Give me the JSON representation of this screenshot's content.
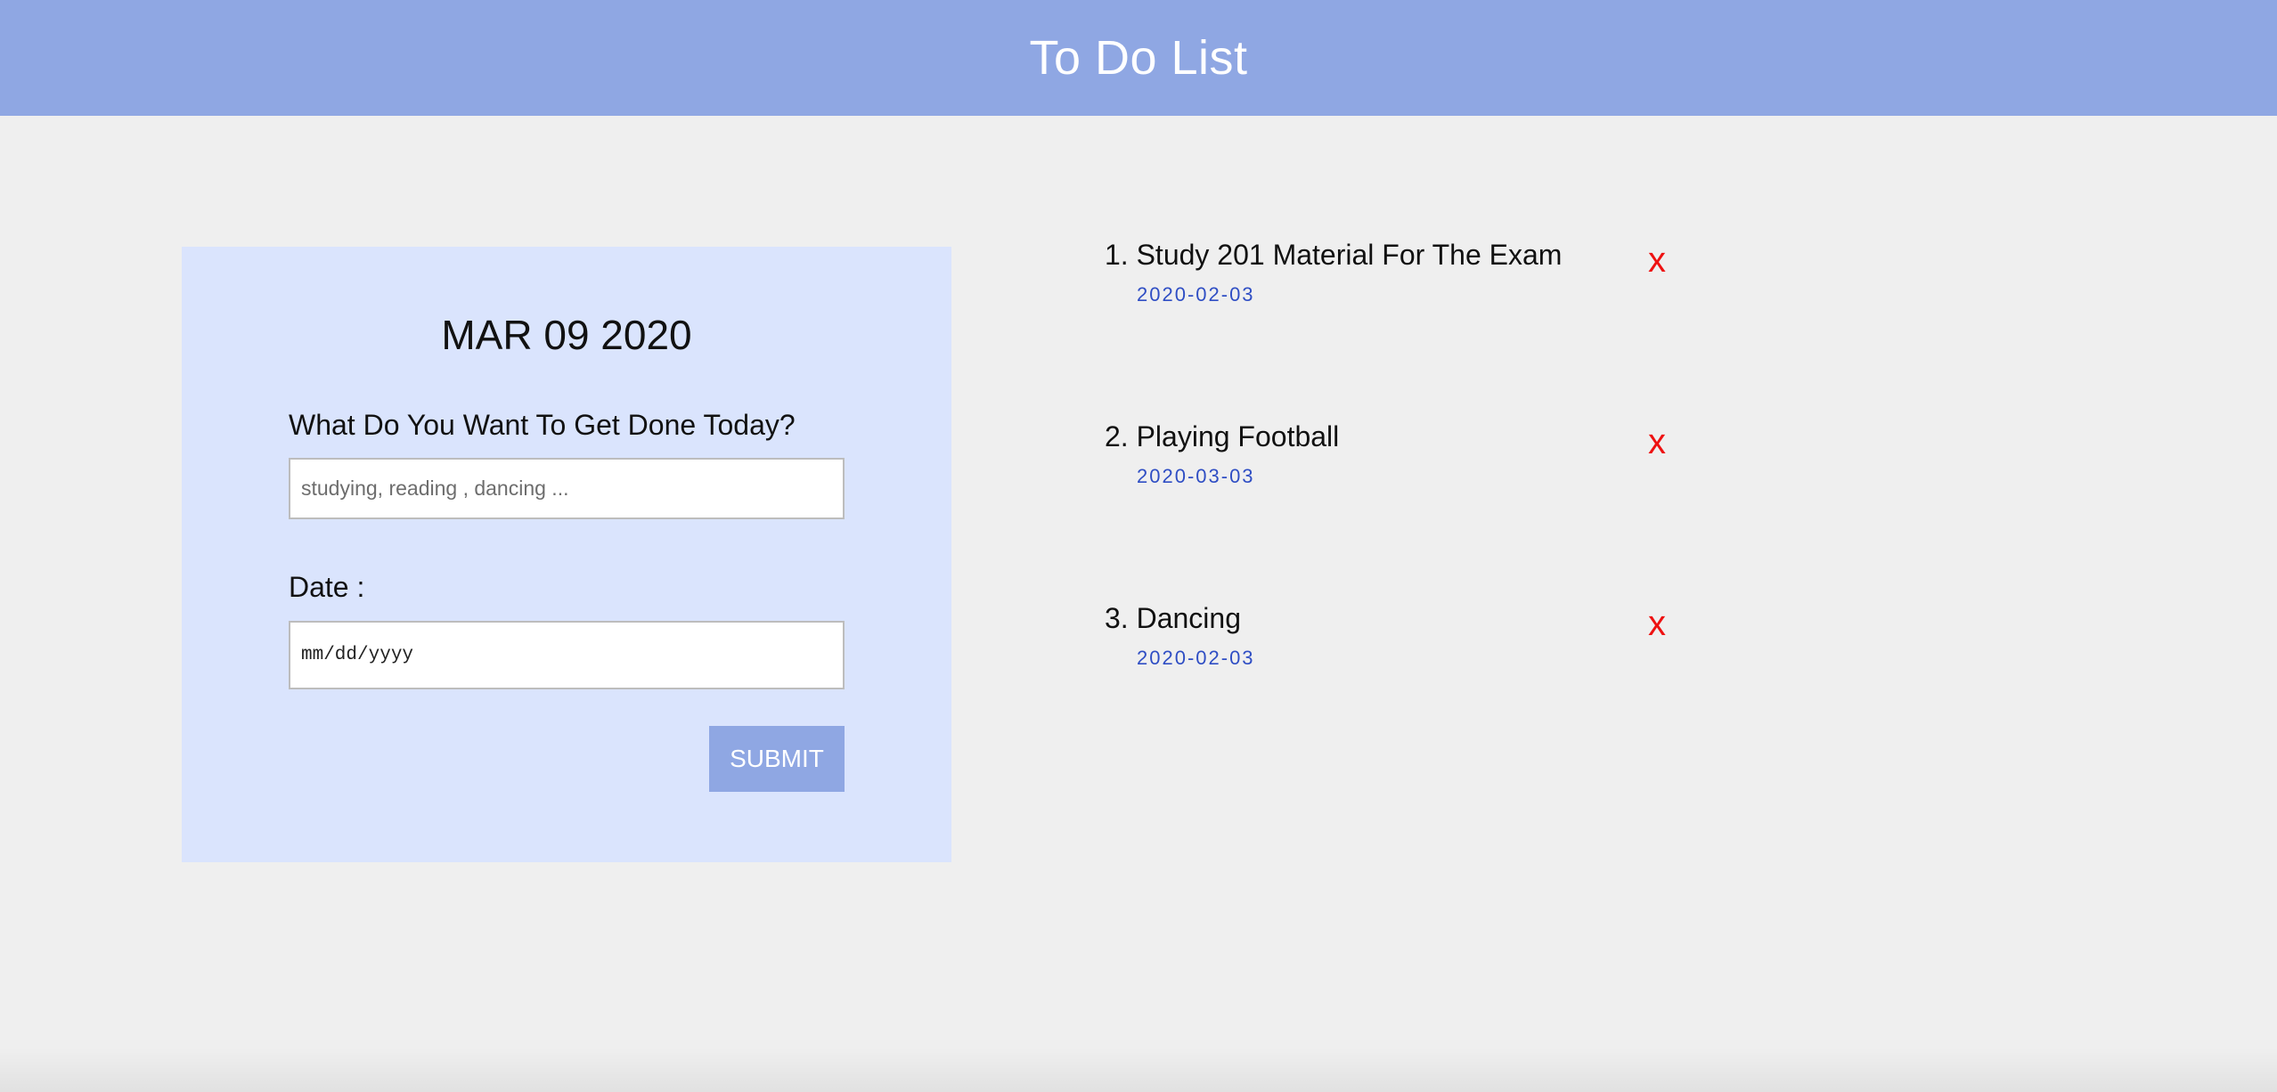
{
  "header": {
    "title": "To Do List"
  },
  "form": {
    "date_heading": "MAR 09 2020",
    "question_label": "What Do You Want To Get Done Today?",
    "task_placeholder": "studying, reading , dancing ...",
    "date_label": "Date :",
    "date_placeholder": "mm/dd/yyyy",
    "submit_label": "SUBMIT"
  },
  "todos": [
    {
      "title": "1. Study 201 Material For The Exam",
      "date": "2020-02-03",
      "delete_label": "x"
    },
    {
      "title": "2. Playing Football",
      "date": "2020-03-03",
      "delete_label": "x"
    },
    {
      "title": "3. Dancing",
      "date": "2020-02-03",
      "delete_label": "x"
    }
  ],
  "colors": {
    "header_bg": "#8fa7e3",
    "card_bg": "#dae4fd",
    "date_text": "#2f4ec4",
    "delete": "#ee1111",
    "page_bg": "#efefef"
  }
}
